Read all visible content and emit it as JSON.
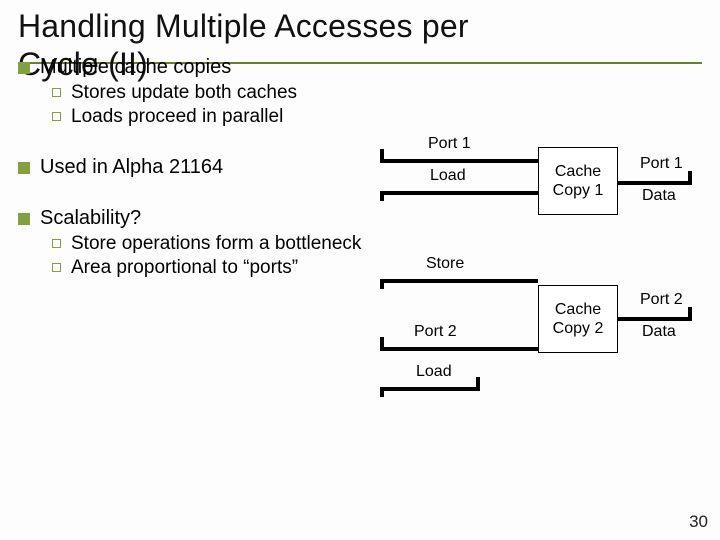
{
  "title_line1": "Handling Multiple Accesses per",
  "title_line2": "Cycle (II)",
  "bullets": {
    "b1": "Multiple cache copies",
    "b1a": "Stores update both caches",
    "b1b": "Loads proceed in parallel",
    "b2": "Used in Alpha 21164",
    "b3": "Scalability?",
    "b3a": "Store operations form a bottleneck",
    "b3b": "Area proportional to “ports”"
  },
  "diagram": {
    "port1_top": "Port 1",
    "load_top": "Load",
    "cache1": "Cache\nCopy 1",
    "port1_right": "Port 1",
    "data_right1": "Data",
    "store": "Store",
    "port2_left": "Port 2",
    "cache2": "Cache\nCopy 2",
    "port2_right": "Port 2",
    "data_right2": "Data",
    "load_bottom": "Load"
  },
  "page_number": "30"
}
